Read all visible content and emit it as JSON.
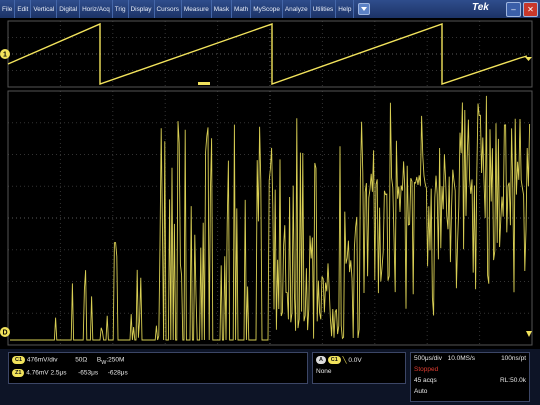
{
  "menu": [
    "File",
    "Edit",
    "Vertical",
    "Digital",
    "Horiz/Acq",
    "Trig",
    "Display",
    "Cursors",
    "Measure",
    "Mask",
    "Math",
    "MyScope",
    "Analyze",
    "Utilities",
    "Help"
  ],
  "brand": "Tek",
  "markers": {
    "ch1": "1",
    "d": "D"
  },
  "channel": {
    "label": "C1",
    "scale": "476mV/div",
    "impedance": "50Ω",
    "bw_prefix": "B",
    "bw_sub": "W",
    "bandwidth": ":250M"
  },
  "zoom": {
    "label": "Z1",
    "scale": "4.76mV",
    "time_div": "2.5μs",
    "pos1": "-653μs",
    "pos2": "-628μs"
  },
  "trigger": {
    "source": "A",
    "channel": "C1",
    "level": "0.0V",
    "mode": "None"
  },
  "acquisition": {
    "time_div": "500μs/div",
    "sample_rate": "10.0MS/s",
    "resolution": "100ns/pt",
    "state": "Stopped",
    "acqs": "45 acqs",
    "record_length": "RL:50.0k",
    "trigger_mode": "Auto"
  },
  "colors": {
    "trace": "#d9cf54",
    "grid": "#3a3a3a",
    "ch1": "#f2e35c",
    "menu": "#1c3366",
    "stopped": "#e03c31"
  },
  "icons": [
    "dropdown-arrow-icon",
    "minimize-icon",
    "close-icon",
    "trigger-slope-icon"
  ]
}
